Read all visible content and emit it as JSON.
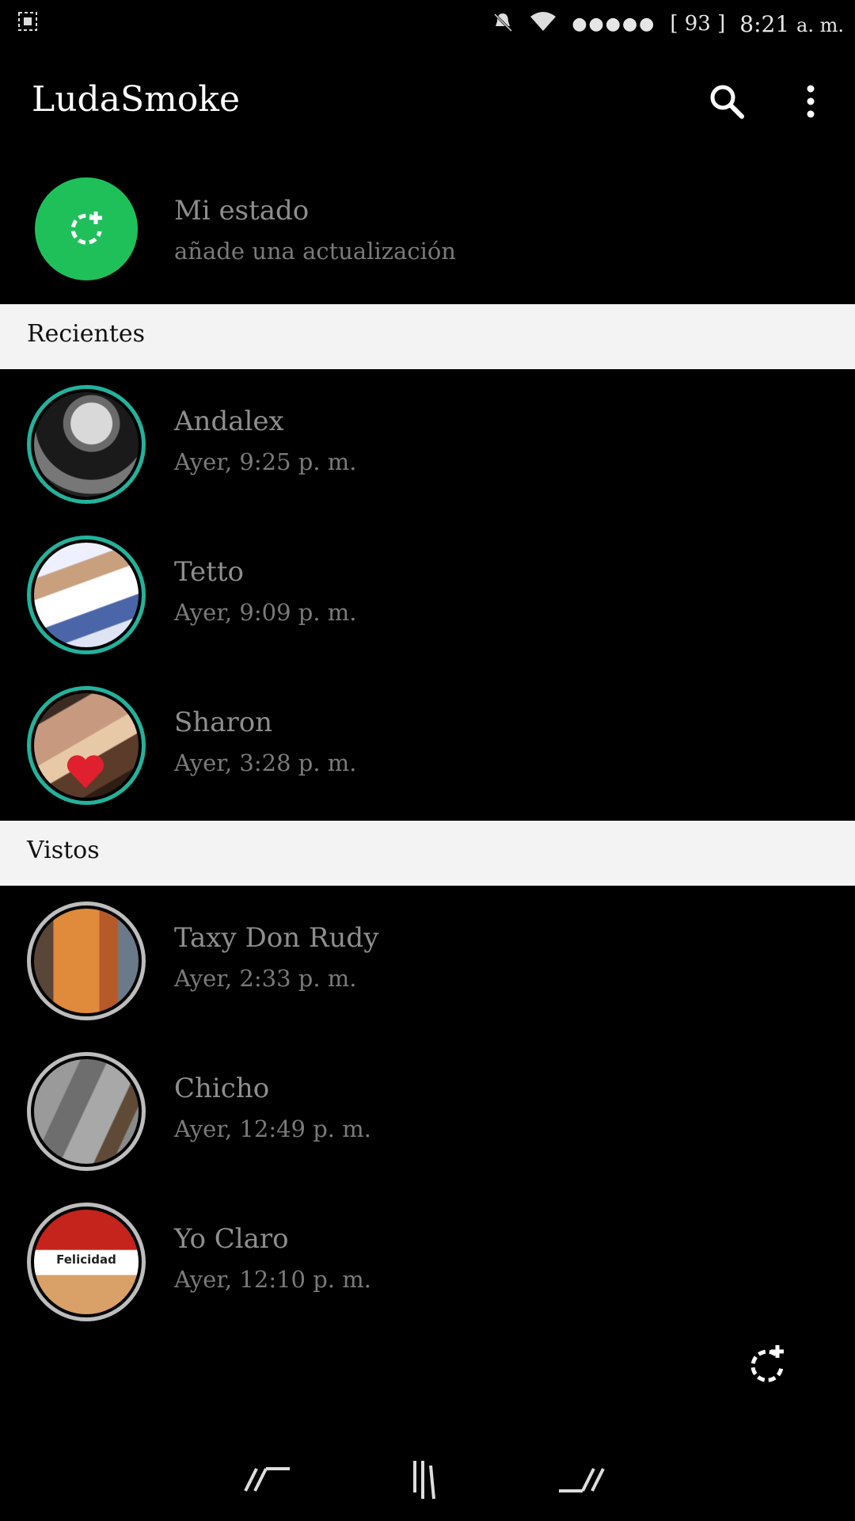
{
  "status_bar": {
    "signal_dots": "●●●●●",
    "battery": "[ 93 ]",
    "time": "8:21",
    "ampm": "a. m."
  },
  "app_bar": {
    "title": "LudaSmoke",
    "icons": [
      "search-icon",
      "more-vert-icon"
    ]
  },
  "my_status": {
    "name": "Mi estado",
    "subtitle": "añade una actualización"
  },
  "sections": {
    "recent": "Recientes",
    "seen": "Vistos"
  },
  "recent": [
    {
      "name": "Andalex",
      "time": "Ayer, 9:25 p. m."
    },
    {
      "name": "Tetto",
      "time": "Ayer, 9:09 p. m."
    },
    {
      "name": "Sharon",
      "time": "Ayer, 3:28 p. m."
    }
  ],
  "seen": [
    {
      "name": "Taxy Don Rudy",
      "time": "Ayer, 2:33 p. m."
    },
    {
      "name": "Chicho",
      "time": "Ayer, 12:49 p. m."
    },
    {
      "name": "Yo Claro",
      "time": "Ayer, 12:10 p. m.",
      "thumb_text": "Felicidad"
    }
  ],
  "colors": {
    "accent_ring": "#23b29c",
    "add_status": "#1fc05a",
    "seen_ring": "#bdbdbd"
  }
}
